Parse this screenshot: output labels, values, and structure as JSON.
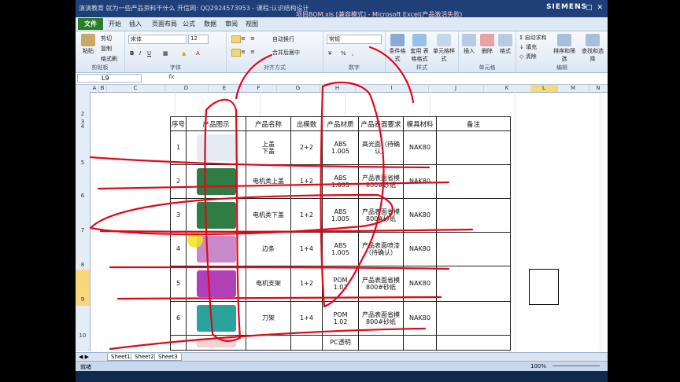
{
  "window": {
    "qa_text": "演演教育 就为一些产品资料干什么 开信网: QQ2924573953 - 课程:认识结构设计",
    "title": "项目BOM.xls [兼容模式] - Microsoft Excel(产品激活失败)",
    "brand": "SIEMENS"
  },
  "tabs": [
    "文件",
    "开始",
    "插入",
    "页面布局",
    "公式",
    "数据",
    "审阅",
    "视图"
  ],
  "ribbon": {
    "clipboard": {
      "paste": "粘贴",
      "cut": "剪切",
      "copy": "复制",
      "format_painter": "格式刷",
      "label": "剪贴板"
    },
    "font": {
      "name": "宋体",
      "size": "12",
      "label": "字体"
    },
    "alignment": {
      "wrap": "自动换行",
      "merge": "合并后居中",
      "label": "对齐方式"
    },
    "number": {
      "format": "常规",
      "label": "数字"
    },
    "styles": {
      "cond": "条件格式",
      "table": "套用\n表格格式",
      "cell": "单元格样式",
      "label": "样式"
    },
    "cells": {
      "insert": "插入",
      "delete": "删除",
      "format": "格式",
      "label": "单元格"
    },
    "editing": {
      "autosum": "自动求和",
      "fill": "填充",
      "clear": "清除",
      "sort": "排序和筛选",
      "find": "查找和选择",
      "label": "编辑"
    }
  },
  "formula_bar": {
    "name_box": "L9",
    "fx": "fx"
  },
  "columns": [
    "A",
    "B",
    "C",
    "D",
    "E",
    "F",
    "G",
    "H",
    "I",
    "J",
    "K",
    "L",
    "M",
    "N"
  ],
  "rows": [
    "2",
    "3",
    "4",
    "5",
    "6",
    "7",
    "8",
    "9",
    "10"
  ],
  "table": {
    "headers": [
      "序号",
      "产品图示",
      "产品名称",
      "出模数",
      "产品材质",
      "产品表面要求",
      "模具材料",
      "备注"
    ],
    "rows": [
      {
        "no": "1",
        "name": "上盖\n下盖",
        "cavity": "2+2",
        "material": "ABS\n1.005",
        "surface": "高光面（待确\n认）",
        "mold": "NAK80",
        "note": "",
        "img": "#e4ebf2"
      },
      {
        "no": "2",
        "name": "电机类上盖",
        "cavity": "1+2",
        "material": "ABS\n1.005",
        "surface": "产品表面省模\n800#砂纸",
        "mold": "NAK80",
        "note": "",
        "img": "#2f7d45"
      },
      {
        "no": "3",
        "name": "电机类下盖",
        "cavity": "1+2",
        "material": "ABS\n1.005",
        "surface": "产品表面省模\n800#砂纸",
        "mold": "NAK80",
        "note": "",
        "img": "#2f7d45"
      },
      {
        "no": "4",
        "name": "边条",
        "cavity": "1+4",
        "material": "ABS\n1.005",
        "surface": "产品表面喷漆\n（待确认）",
        "mold": "NAK80",
        "note": "",
        "img": "#c789c9"
      },
      {
        "no": "5",
        "name": "电机支架",
        "cavity": "1+2",
        "material": "POM\n1.02",
        "surface": "产品表面省模\n800#砂纸",
        "mold": "NAK80",
        "note": "",
        "img": "#b03fb8"
      },
      {
        "no": "6",
        "name": "刀架",
        "cavity": "1+4",
        "material": "POM\n1.02",
        "surface": "产品表面省模\n800#砂纸",
        "mold": "NAK80",
        "note": "",
        "img": "#2aa39a"
      },
      {
        "no": "",
        "name": "",
        "cavity": "",
        "material": "PC透明",
        "surface": "",
        "mold": "",
        "note": "",
        "img": "#f4d3d3"
      }
    ]
  },
  "sheets": [
    "Sheet1",
    "Sheet2",
    "Sheet3"
  ],
  "status": {
    "ready": "就绪",
    "zoom": "100%"
  },
  "colors": {
    "title_bar": "#1e3f78",
    "file_tab": "#2a7d2a",
    "ink": "#e0071a"
  }
}
